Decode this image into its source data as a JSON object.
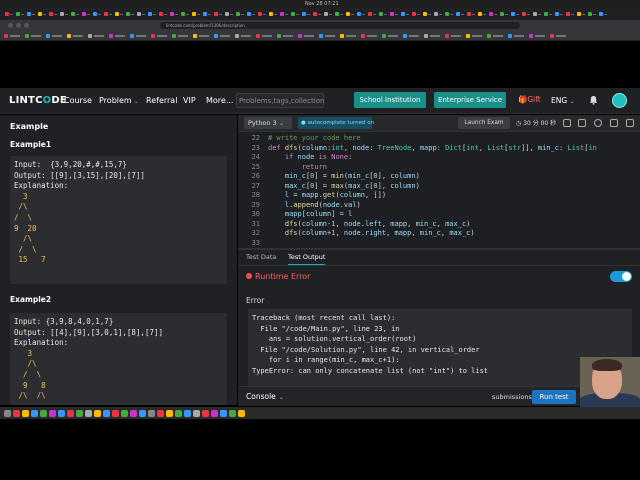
{
  "menubar": {
    "clock": "Nov 28 07:21"
  },
  "browser": {
    "url": "lintcode.com/problem/1306/description"
  },
  "header": {
    "logo_a": "LINTC",
    "logo_b": "O",
    "logo_c": "DE",
    "nav": [
      "Course",
      "Problem",
      "Referral",
      "VIP",
      "More..."
    ],
    "search_placeholder": "Problems,tags,collection",
    "school_btn": "School Institution",
    "enterprise_btn": "Enterprise Service",
    "gift": "Gift",
    "lang": "ENG"
  },
  "left": {
    "title": "Example",
    "ex1_title": "Example1",
    "ex1_lines": [
      "Input:  {3,9,20,#,#,15,7}",
      "Output: [[9],[3,15],[20],[7]]",
      "Explanation:",
      "  3",
      " /\\",
      "/  \\",
      "9  20",
      "  /\\",
      " /  \\",
      " 15   7"
    ],
    "ex2_title": "Example2",
    "ex2_lines": [
      "Input: {3,9,8,4,0,1,7}",
      "Output: [[4],[9],[3,0,1],[8],[7]]",
      "Explanation:",
      "   3",
      "   /\\",
      "  /  \\",
      "  9   8",
      " /\\  /\\"
    ]
  },
  "toolbar": {
    "language": "Python 3",
    "autocomplete": "autocomplete turned on",
    "launch": "Launch Exam",
    "timer": "30 分 00 秒"
  },
  "editor": {
    "line_numbers": [
      "22",
      "23",
      "24",
      "25",
      "26",
      "27",
      "28",
      "29",
      "30",
      "31",
      "32",
      "33"
    ],
    "lines": [
      "# write your code here",
      "def dfs(column:int, node: TreeNode, mapp: Dict[int, List[str]], min_c: List[in",
      "    if node is None:",
      "        return",
      "    min_c[0] = min(min_c[0], column)",
      "    max_c[0] = max(max_c[0], column)",
      "    l = mapp.get(column, [])",
      "    l.append(node.val)",
      "    mapp[column] = l",
      "    dfs(column-1, node.left, mapp, min_c, max_c)",
      "    dfs(column+1, node.right, mapp, min_c, max_c)",
      ""
    ]
  },
  "result": {
    "tabs": [
      "Test Data",
      "Test Output"
    ],
    "status": "Runtime Error",
    "error_label": "Error",
    "trace": [
      "Traceback (most recent call last):",
      "  File \"/code/Main.py\", line 23, in",
      "    ans = solution.vertical_order(root)",
      "  File \"/code/Solution.py\", line 42, in vertical_order",
      "    for i in range(min_c, max_c+1):",
      "TypeError: can only concatenate list (not \"int\") to list"
    ]
  },
  "bottom": {
    "console": "Console",
    "submissions": "submissions",
    "run": "Run test"
  }
}
